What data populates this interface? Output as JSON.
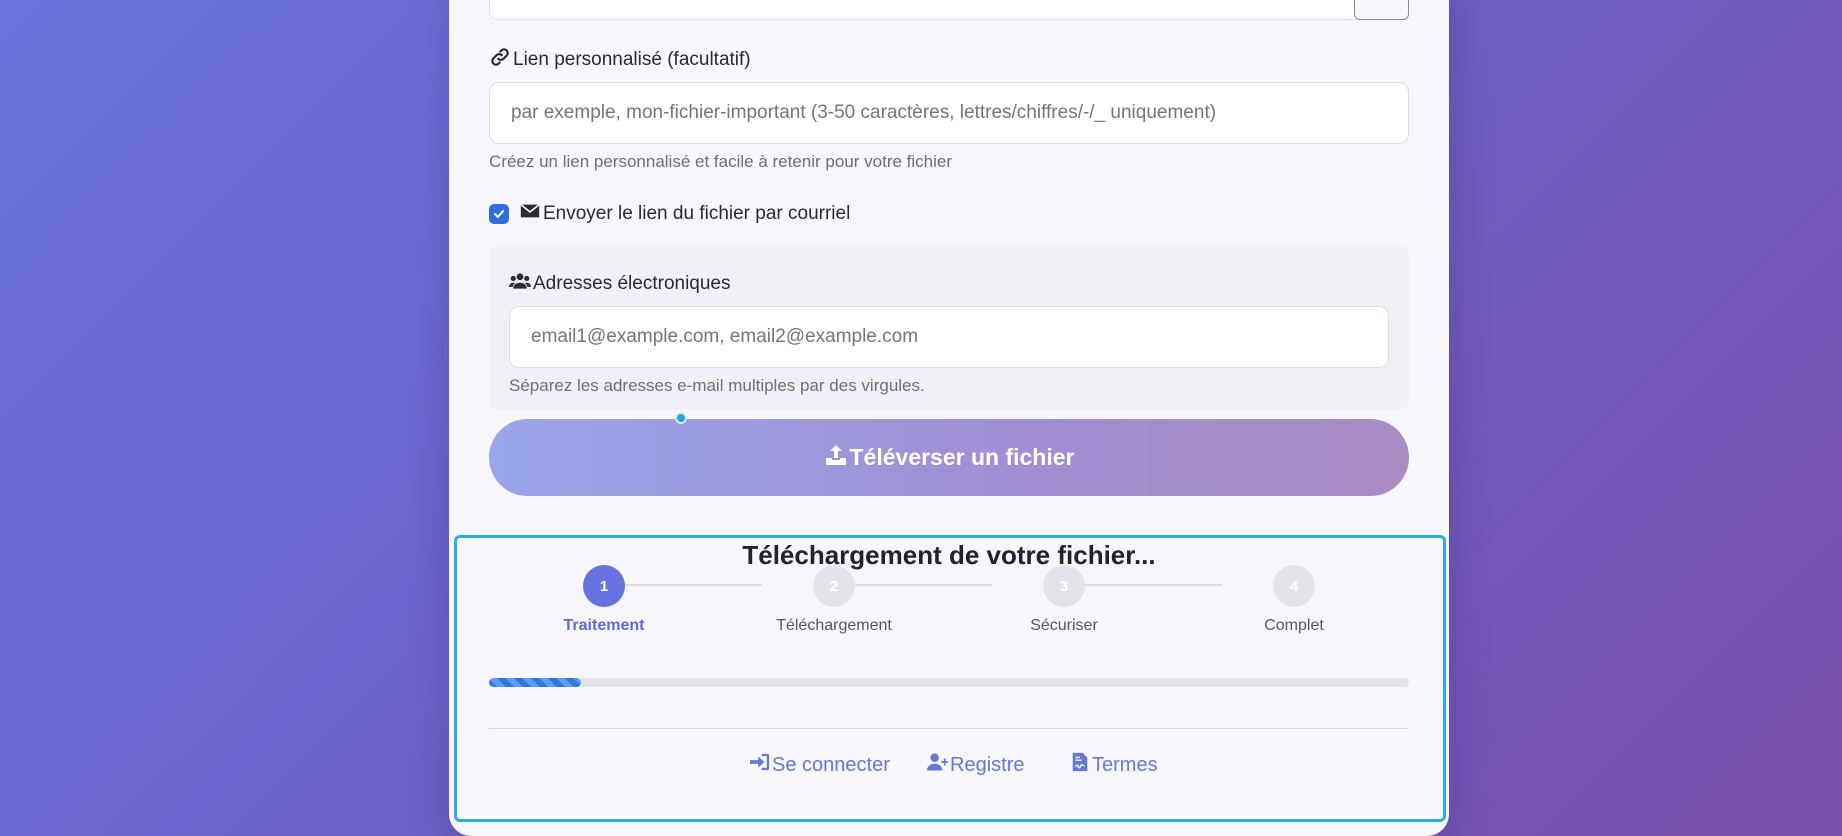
{
  "form": {
    "custom_link": {
      "label": "Lien personnalisé (facultatif)",
      "placeholder": "par exemple, mon-fichier-important (3-50 caractères, lettres/chiffres/-/_ uniquement)",
      "hint": "Créez un lien personnalisé et facile à retenir pour votre fichier"
    },
    "send_email": {
      "label": "Envoyer le lien du fichier par courriel",
      "checked": true
    },
    "emails": {
      "label": "Adresses électroniques",
      "placeholder": "email1@example.com, email2@example.com",
      "hint": "Séparez les adresses e-mail multiples par des virgules."
    },
    "upload_button": "Téléverser un fichier"
  },
  "progress": {
    "title": "Téléchargement de votre fichier...",
    "steps": [
      {
        "number": "1",
        "label": "Traitement",
        "active": true
      },
      {
        "number": "2",
        "label": "Téléchargement",
        "active": false
      },
      {
        "number": "3",
        "label": "Sécuriser",
        "active": false
      },
      {
        "number": "4",
        "label": "Complet",
        "active": false
      }
    ],
    "percent": 10
  },
  "footer": {
    "login": "Se connecter",
    "register": "Registre",
    "terms": "Termes"
  },
  "colors": {
    "accent": "#6673e0",
    "checkbox": "#2f6fdf",
    "focus_outline": "#2bb0d8",
    "link": "#6677d8"
  },
  "icons": {
    "custom_link": "link-icon",
    "send_email": "envelope-icon",
    "emails": "users-icon",
    "upload": "upload-icon",
    "login": "sign-in-icon",
    "register": "user-plus-icon",
    "terms": "file-contract-icon"
  }
}
